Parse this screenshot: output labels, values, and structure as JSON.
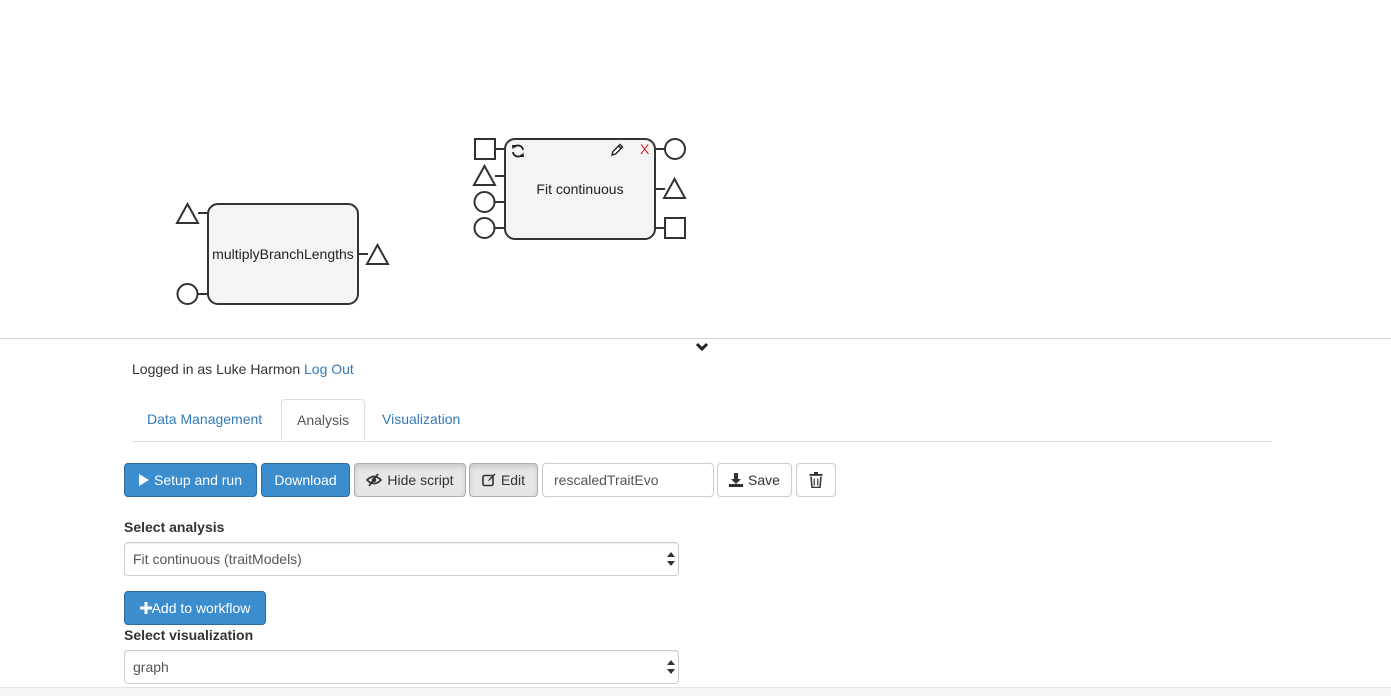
{
  "workflow": {
    "nodes": [
      {
        "label": "multiplyBranchLengths"
      },
      {
        "label": "Fit continuous",
        "close_symbol": "X",
        "close_color": "#d9232d"
      }
    ]
  },
  "session": {
    "prefix": "Logged in as Luke Harmon",
    "logout_label": "Log Out"
  },
  "tabs": [
    {
      "label": "Data Management",
      "active": false
    },
    {
      "label": "Analysis",
      "active": true
    },
    {
      "label": "Visualization",
      "active": false
    }
  ],
  "toolbar": {
    "setup_run_label": "Setup and run",
    "download_label": "Download",
    "hide_script_label": "Hide script",
    "edit_label": "Edit",
    "workflow_name_value": "rescaledTraitEvo",
    "save_label": "Save",
    "delete_icon": "trash-icon"
  },
  "analysis": {
    "select_label": "Select analysis",
    "selected": "Fit continuous (traitModels)",
    "add_label": "Add to workflow"
  },
  "visualization": {
    "select_label": "Select visualization",
    "selected": "graph"
  },
  "colors": {
    "primary": "#3c8dcd",
    "link": "#337ab7",
    "close": "#d9232d"
  }
}
